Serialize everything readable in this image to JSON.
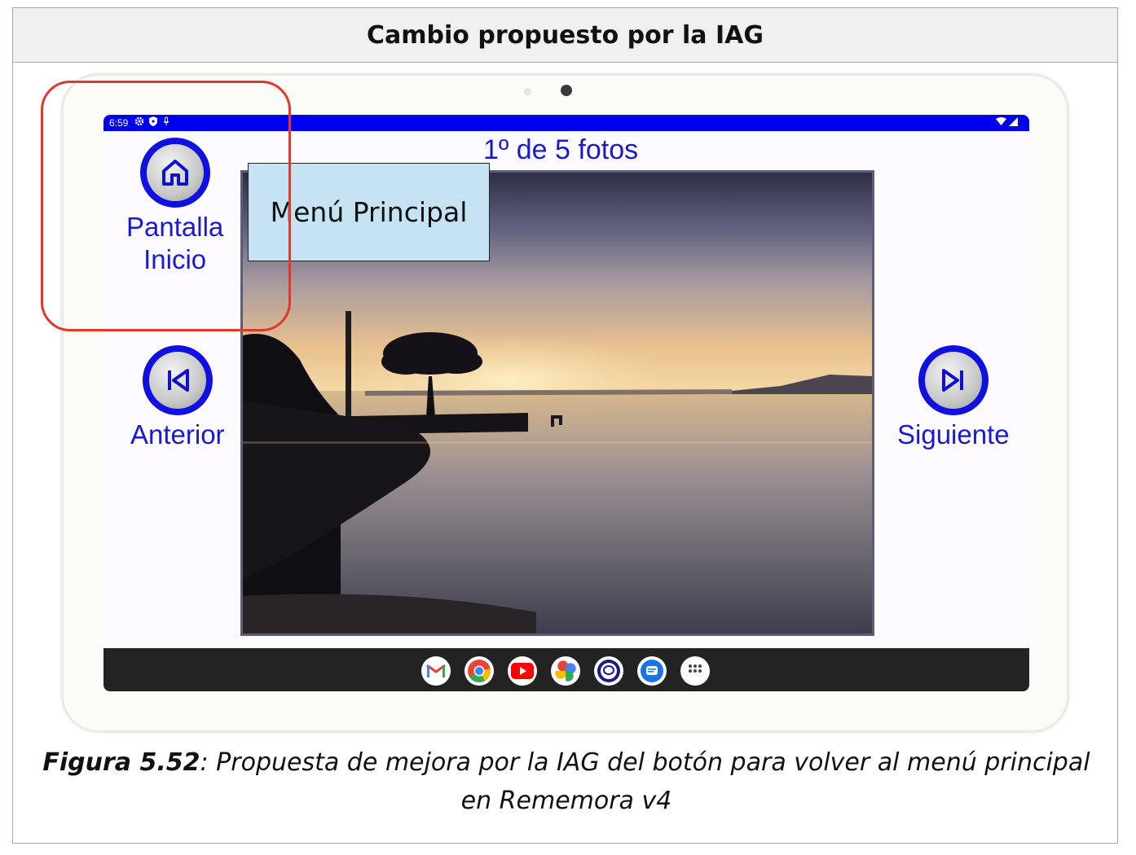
{
  "header": {
    "title": "Cambio propuesto por la IAG"
  },
  "statusbar": {
    "time": "6:59"
  },
  "viewer": {
    "counter": "1º de 5 fotos"
  },
  "buttons": {
    "home_line1": "Pantalla",
    "home_line2": "Inicio",
    "previous": "Anterior",
    "next": "Siguiente"
  },
  "callout": {
    "text": "Menú Principal"
  },
  "dock": {
    "apps": [
      "gmail-icon",
      "chrome-icon",
      "youtube-icon",
      "photos-icon",
      "rememora-icon",
      "messages-icon",
      "app-drawer-icon"
    ]
  },
  "caption": {
    "label": "Figura 5.52",
    "text": ": Propuesta de mejora por la IAG del botón para volver al menú principal en Rememora v4"
  },
  "colors": {
    "accent_blue": "#1a1ad0",
    "statusbar": "#0000f0",
    "callout_bg": "#c6e3f3",
    "highlight_red": "#e2382c"
  }
}
